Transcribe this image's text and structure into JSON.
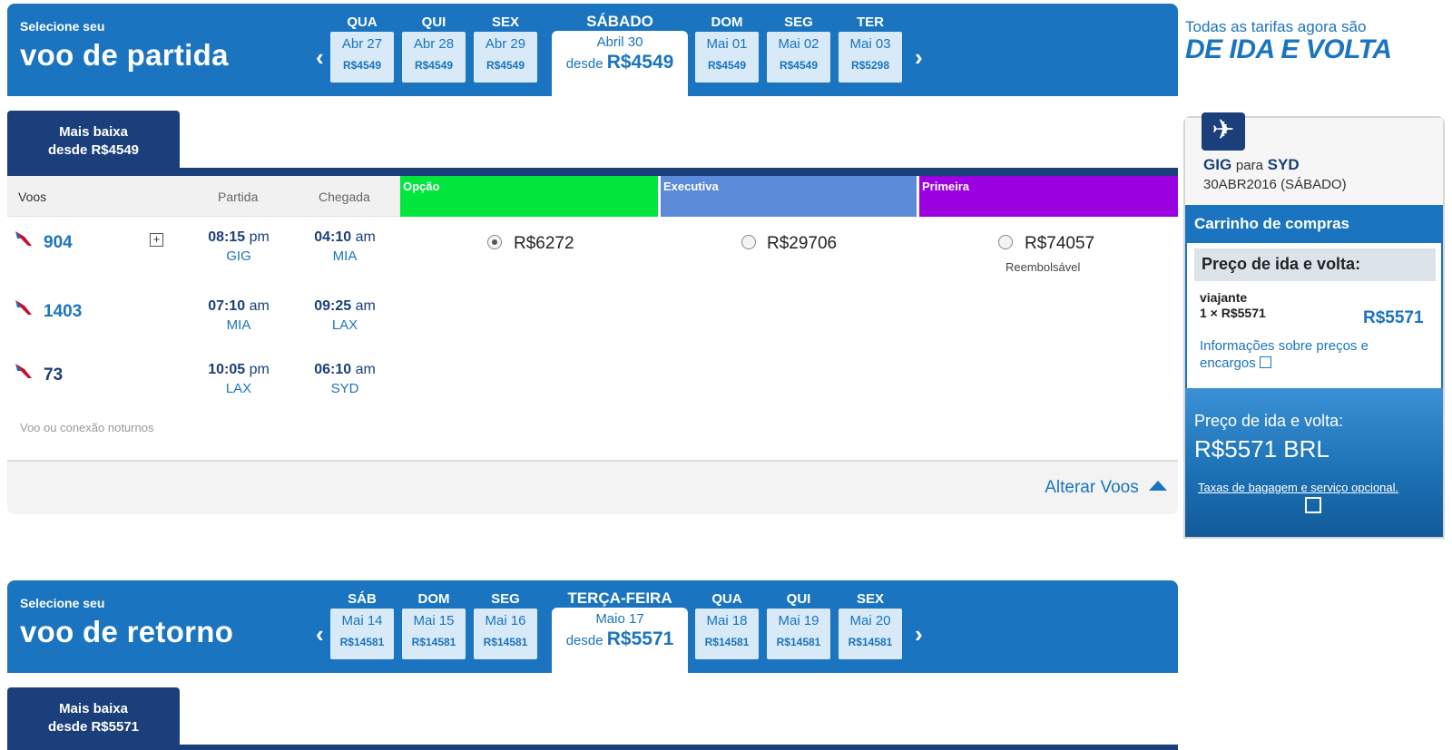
{
  "departure": {
    "select_label": "Selecione seu",
    "heading": "voo de partida",
    "prev_arrow": "‹",
    "next_arrow": "›",
    "days": [
      {
        "dname": "QUA",
        "date": "Abr 27",
        "price": "R$4549"
      },
      {
        "dname": "QUI",
        "date": "Abr 28",
        "price": "R$4549"
      },
      {
        "dname": "SEX",
        "date": "Abr 29",
        "price": "R$4549"
      },
      {
        "dname": "SÁBADO",
        "date": "Abril 30",
        "from": "desde",
        "price": "R$4549"
      },
      {
        "dname": "DOM",
        "date": "Mai 01",
        "price": "R$4549"
      },
      {
        "dname": "SEG",
        "date": "Mai 02",
        "price": "R$4549"
      },
      {
        "dname": "TER",
        "date": "Mai 03",
        "price": "R$5298"
      }
    ],
    "lowest_tab": {
      "line1": "Mais baixa",
      "line2": "desde R$4549"
    },
    "columns": {
      "flights": "Voos",
      "departure": "Partida",
      "arrival": "Chegada"
    },
    "fares": {
      "option": "Opção",
      "business": "Executiva",
      "first": "Primeira"
    },
    "flights": [
      {
        "number": "904",
        "dep_time": "08:15",
        "dep_ampm": "pm",
        "dep_ap": "GIG",
        "arr_time": "04:10",
        "arr_ampm": "am",
        "arr_ap": "MIA"
      },
      {
        "number": "1403",
        "dep_time": "07:10",
        "dep_ampm": "am",
        "dep_ap": "MIA",
        "arr_time": "09:25",
        "arr_ampm": "am",
        "arr_ap": "LAX"
      },
      {
        "number": "73",
        "dep_time": "10:05",
        "dep_ampm": "pm",
        "dep_ap": "LAX",
        "arr_time": "06:10",
        "arr_ampm": "am",
        "arr_ap": "SYD"
      }
    ],
    "expand_symbol": "+",
    "prices": {
      "option": "R$6272",
      "business": "R$29706",
      "first": "R$74057",
      "first_note": "Reembolsável"
    },
    "night_note": "Voo ou conexão noturnos",
    "change_flights": "Alterar Voos"
  },
  "return": {
    "select_label": "Selecione seu",
    "heading": "voo de retorno",
    "prev_arrow": "‹",
    "next_arrow": "›",
    "days": [
      {
        "dname": "SÁB",
        "date": "Mai 14",
        "price": "R$14581"
      },
      {
        "dname": "DOM",
        "date": "Mai 15",
        "price": "R$14581"
      },
      {
        "dname": "SEG",
        "date": "Mai 16",
        "price": "R$14581"
      },
      {
        "dname": "TERÇA-FEIRA",
        "date": "Maio 17",
        "from": "desde",
        "price": "R$5571"
      },
      {
        "dname": "QUA",
        "date": "Mai 18",
        "price": "R$14581"
      },
      {
        "dname": "QUI",
        "date": "Mai 19",
        "price": "R$14581"
      },
      {
        "dname": "SEX",
        "date": "Mai 20",
        "price": "R$14581"
      }
    ],
    "lowest_tab": {
      "line1": "Mais baixa",
      "line2": "desde R$5571"
    }
  },
  "promo": {
    "line1": "Todas as tarifas agora são",
    "line2": "DE IDA E VOLTA"
  },
  "sidebar": {
    "origin": "GIG",
    "to": "para",
    "destination": "SYD",
    "date": "30ABR2016 (SÁBADO)",
    "cart_title": "Carrinho de compras",
    "roundtrip_label": "Preço de ida e volta:",
    "traveler": "viajante",
    "traveler_calc": "1 × R$5571",
    "traveler_total": "R$5571",
    "info_link": "Informações sobre preços e encargos",
    "total_label": "Preço de ida e volta:",
    "total_value": "R$5571 BRL",
    "baggage_link": "Taxas de bagagem e serviço opcional."
  },
  "colors": {
    "brand_blue": "#1a74bf",
    "navy": "#1b3f7a",
    "option_green": "#00e63c",
    "business_blue": "#5b8ad8",
    "first_purple": "#9b00e0"
  }
}
